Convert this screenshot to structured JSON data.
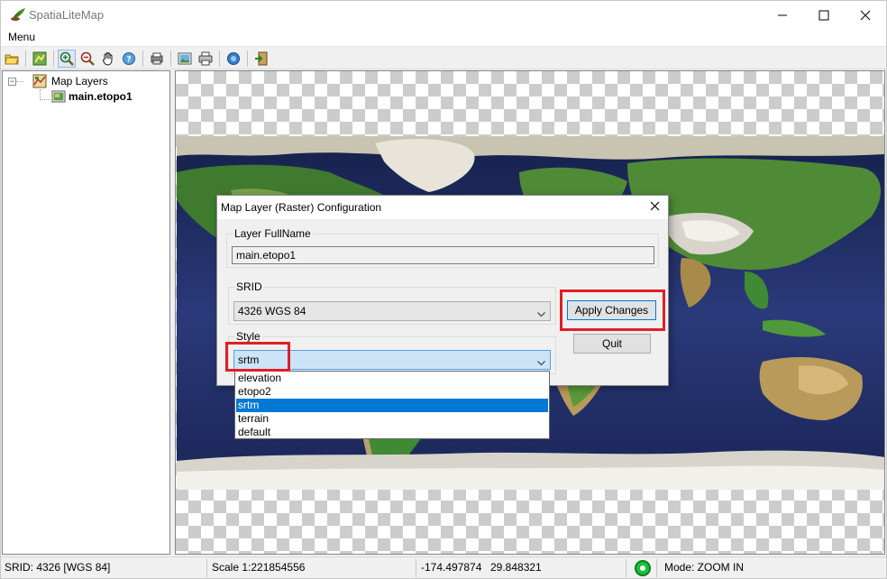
{
  "window": {
    "title": "SpatiaLiteMap",
    "controls": {
      "minimize": "minimize-icon",
      "maximize": "maximize-icon",
      "close": "close-icon"
    }
  },
  "menubar": {
    "items": [
      "Menu"
    ]
  },
  "toolbar": {
    "buttons": [
      "open-folder-icon",
      "layer-config-icon",
      "zoom-in-icon",
      "zoom-out-icon",
      "pan-hand-icon",
      "identify-icon",
      "printer-setup-icon",
      "export-image-icon",
      "print-icon",
      "about-icon",
      "exit-icon"
    ],
    "active_button": "zoom-in-icon"
  },
  "tree": {
    "root_label": "Map Layers",
    "layers": [
      {
        "label": "main.etopo1",
        "bold": true
      }
    ]
  },
  "statusbar": {
    "srid": "SRID: 4326 [WGS 84]",
    "scale": "Scale 1:221854556",
    "longitude": "-174.497874",
    "latitude": "29.848321",
    "mode": "Mode: ZOOM IN",
    "status_color": "#18c038"
  },
  "dialog": {
    "title": "Map Layer (Raster) Configuration",
    "fullname_group_label": "Layer FullName",
    "fullname_value": "main.etopo1",
    "srid_group_label": "SRID",
    "srid_value": "4326 WGS 84",
    "style_group_label": "Style",
    "style_value": "srtm",
    "style_options": [
      "elevation",
      "etopo2",
      "srtm",
      "terrain",
      "default"
    ],
    "style_selected_index": 2,
    "apply_label": "Apply Changes",
    "quit_label": "Quit"
  },
  "highlight_color": "#e01f26",
  "accent_color": "#0078d7"
}
